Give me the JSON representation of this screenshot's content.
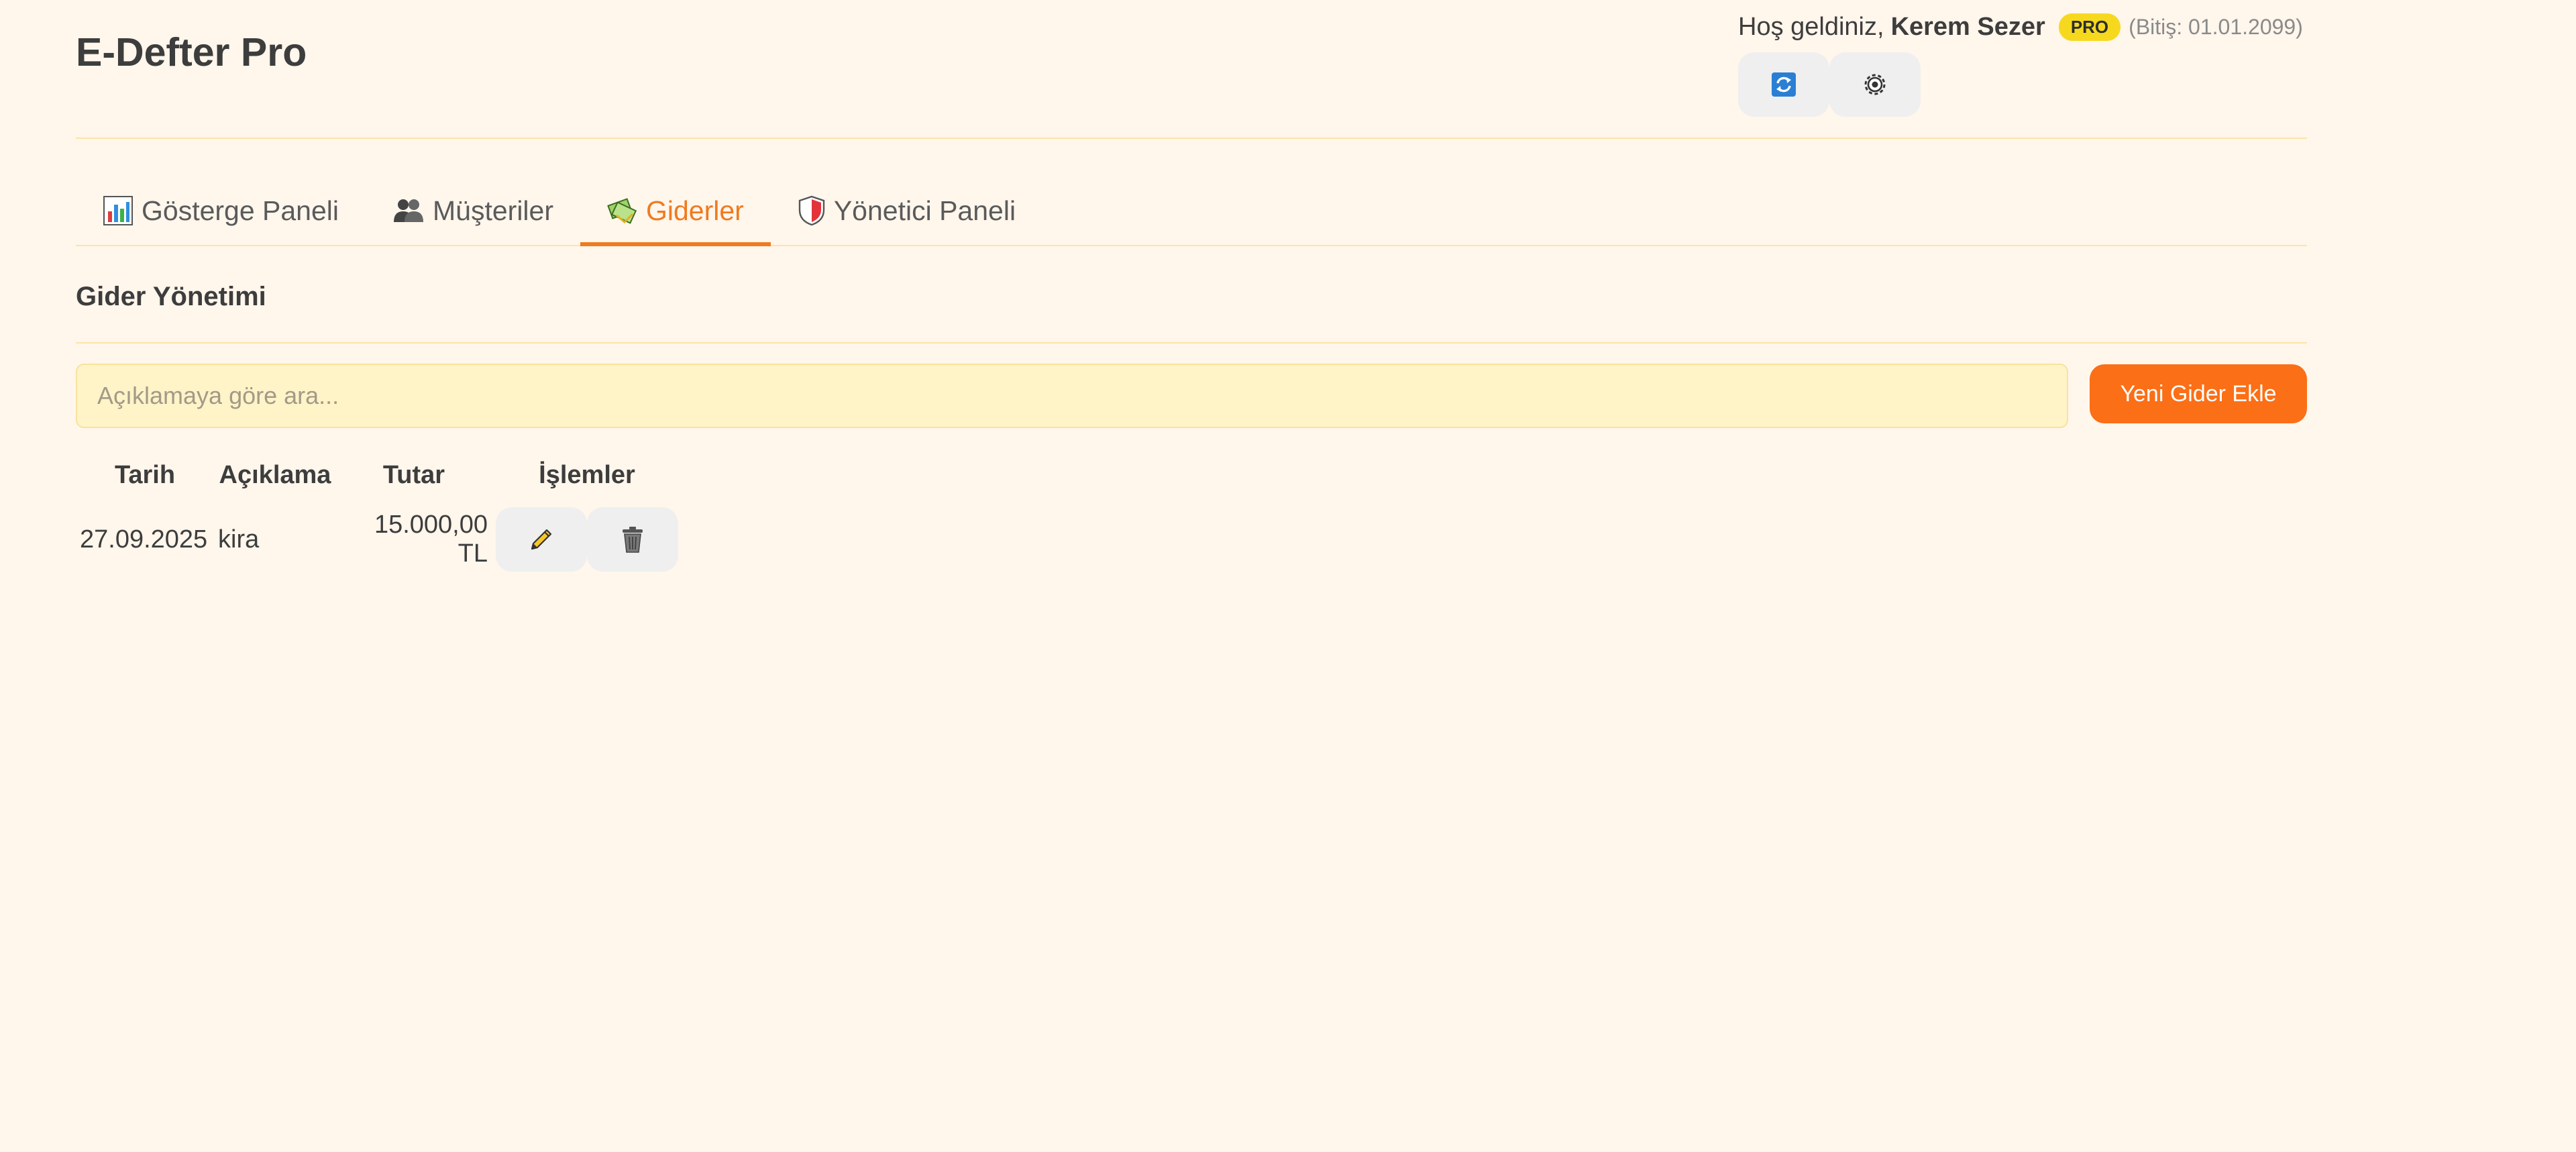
{
  "app": {
    "title": "E-Defter Pro"
  },
  "user": {
    "welcome": "Hoş geldiniz,",
    "name": "Kerem Sezer",
    "badge": "PRO",
    "expiry": "(Bitiş: 01.01.2099)"
  },
  "header_buttons": {
    "refresh_icon": "refresh-icon",
    "settings_icon": "gear-icon"
  },
  "tabs": [
    {
      "label": "Gösterge Paneli",
      "icon": "bar-chart-icon",
      "active": false
    },
    {
      "label": "Müşteriler",
      "icon": "users-icon",
      "active": false
    },
    {
      "label": "Giderler",
      "icon": "money-icon",
      "active": true
    },
    {
      "label": "Yönetici Paneli",
      "icon": "shield-icon",
      "active": false
    }
  ],
  "section": {
    "title": "Gider Yönetimi"
  },
  "search": {
    "placeholder": "Açıklamaya göre ara...",
    "value": ""
  },
  "toolbar": {
    "add_label": "Yeni Gider Ekle"
  },
  "table": {
    "columns": [
      "Tarih",
      "Açıklama",
      "Tutar",
      "İşlemler"
    ],
    "rows": [
      {
        "date": "27.09.2025",
        "description": "kira",
        "amount": "15.000,00 TL"
      }
    ]
  },
  "colors": {
    "background": "#fff6ec",
    "accent": "#fb6f16",
    "active_tab": "#f07a1f",
    "badge": "#f6d91e",
    "search_bg": "#fff3c8"
  }
}
